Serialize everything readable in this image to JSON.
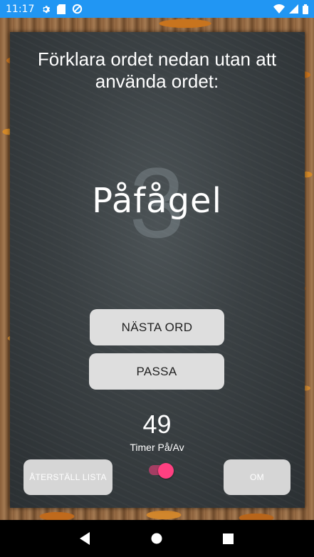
{
  "status_bar": {
    "time": "11:17",
    "icons_left": [
      "gear-icon",
      "sd-card-icon",
      "sync-icon"
    ],
    "icons_right": [
      "wifi-icon",
      "signal-icon",
      "battery-icon"
    ]
  },
  "game": {
    "instruction": "Förklara ordet nedan utan att använda ordet:",
    "countdown": "3",
    "word": "Påfågel",
    "next_button": "NÄSTA ORD",
    "pass_button": "PASSA",
    "timer_value": "49",
    "timer_label": "Timer På/Av",
    "timer_enabled": true,
    "reset_button": "ÅTERSTÄLL LISTA",
    "about_button": "OM"
  },
  "nav_bar": {
    "buttons": [
      "back-icon",
      "home-icon",
      "recents-icon"
    ]
  },
  "colors": {
    "status_bar": "#2196f3",
    "toggle_accent": "#ff4081",
    "button_bg": "#dedede"
  }
}
